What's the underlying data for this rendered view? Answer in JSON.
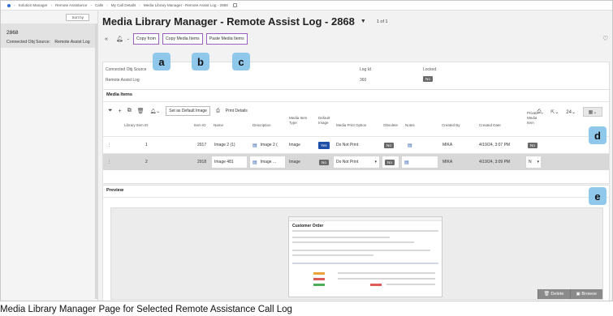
{
  "breadcrumb": [
    "Solution Manager",
    "Remote Assistance",
    "Calls",
    "My Call Details",
    "Media Library Manager - Remote Assist Log - 2868"
  ],
  "left": {
    "sort_by": "Sort by",
    "item_title": "2868",
    "item_label": "Connected Obj Source:",
    "item_value": "Remote Assist Log"
  },
  "header": {
    "title": "Media Library Manager - Remote Assist Log - 2868",
    "page_count": "1 of 1"
  },
  "actions": {
    "copy_from": "Copy from",
    "copy_media_items": "Copy Media Items",
    "paste_media_items": "Paste Media Items"
  },
  "callouts": [
    "a",
    "b",
    "c",
    "d",
    "e"
  ],
  "info": {
    "connected_label": "Connected Obj Source",
    "connected_value": "Remote Assist Log",
    "logid_label": "Log Id",
    "logid_value": "360",
    "locked_label": "Locked",
    "locked_value": "No"
  },
  "media": {
    "title": "Media Items",
    "set_default": "Set as Default Image",
    "print_details": "Print Details",
    "page_size": "24",
    "columns": [
      "Library Item ID",
      "Item ID",
      "Name",
      "Description",
      "Media Item Type",
      "Default Image",
      "Media Print Option",
      "Obsolete",
      "Notes",
      "Created By",
      "Created Date",
      "Private Media Item"
    ],
    "rows": [
      {
        "library_item_id": "1",
        "item_id": "2917",
        "name": "Image 2 (1)",
        "description": "Image 2 (",
        "type": "Image",
        "default": "Yes",
        "print_option": "Do Not Print",
        "obsolete": "No",
        "created_by": "MIKA",
        "created_date": "4/19/24, 3:07 PM",
        "private": "No"
      },
      {
        "library_item_id": "2",
        "item_id": "2918",
        "name": "Image 481",
        "description": "Image ...",
        "type": "Image",
        "default": "No",
        "print_option": "Do Not Print",
        "obsolete": "No",
        "created_by": "MIKA",
        "created_date": "4/19/24, 3:09 PM",
        "private": "N"
      }
    ]
  },
  "preview": {
    "title": "Preview",
    "mini_title": "Customer Order",
    "delete": "Delete",
    "browse": "Browse"
  },
  "caption": "Media Library Manager Page for Selected Remote Assistance Call Log",
  "colors": {
    "callout": "#8fc8ea",
    "action_border": "#9b5fc0",
    "yes_badge": "#1d4ea8",
    "no_badge": "#6a6a6a"
  }
}
